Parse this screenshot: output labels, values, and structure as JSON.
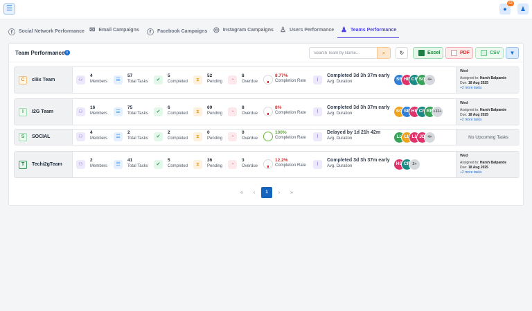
{
  "topbar": {
    "notification_count": "63"
  },
  "tabs": [
    {
      "label": "Social Network Performance",
      "icon": "facebook-icon"
    },
    {
      "label": "Email Campaigns",
      "icon": "email-icon"
    },
    {
      "label": "Facebook Campaigns",
      "icon": "facebook-icon"
    },
    {
      "label": "Instagram Campaigns",
      "icon": "instagram-icon"
    },
    {
      "label": "Users Performance",
      "icon": "users-gear-icon"
    },
    {
      "label": "Teams Performance",
      "icon": "teams-icon",
      "active": true
    }
  ],
  "panel": {
    "title": "Team Performance",
    "search_placeholder": "Search Team by Name...",
    "export": {
      "excel": "Excel",
      "pdf": "PDF",
      "csv": "CSV"
    }
  },
  "colors": {
    "accent": "#4f46e5",
    "primary": "#1565c0",
    "danger": "#dc2626",
    "success": "#5aa831"
  },
  "teams": [
    {
      "badge": "C",
      "name": "cliix Team",
      "members": "4",
      "members_label": "Members",
      "total": "57",
      "total_label": "Total Tasks",
      "completed": "5",
      "completed_label": "Completed",
      "pending": "52",
      "pending_label": "Pending",
      "overdue": "8",
      "overdue_label": "Overdue",
      "rate": "8.77%",
      "rate_label": "Completion Rate",
      "duration": "Completed 3d 3h 37m early",
      "duration_label": "Avg. Duration",
      "avatars": [
        "SB",
        "HB",
        "CR",
        "SG"
      ],
      "more": "4+",
      "upcoming": {
        "day": "Wed",
        "assigned_prefix": "Assigned to:",
        "assigned": "Harsh Balpande",
        "due_prefix": "Due:",
        "due": "18 Aug 2025",
        "more": "+2 more tasks"
      }
    },
    {
      "badge": "I",
      "name": "I2G Team",
      "members": "16",
      "members_label": "Members",
      "total": "75",
      "total_label": "Total Tasks",
      "completed": "6",
      "completed_label": "Completed",
      "pending": "69",
      "pending_label": "Pending",
      "overdue": "8",
      "overdue_label": "Overdue",
      "rate": "8%",
      "rate_label": "Completion Rate",
      "duration": "Completed 3d 3h 37m early",
      "duration_label": "Avg. Duration",
      "avatars": [
        "SG",
        "SB",
        "HB",
        "CR",
        "RR"
      ],
      "more": "+11+",
      "upcoming": {
        "day": "Wed",
        "assigned_prefix": "Assigned to:",
        "assigned": "Harsh Balpande",
        "due_prefix": "Due:",
        "due": "18 Aug 2025",
        "more": "+2 more tasks"
      }
    },
    {
      "badge": "S",
      "name": "SOCIAL",
      "members": "4",
      "members_label": "Members",
      "total": "2",
      "total_label": "Total Tasks",
      "completed": "2",
      "completed_label": "Completed",
      "pending": "0",
      "pending_label": "Pending",
      "overdue": "0",
      "overdue_label": "Overdue",
      "rate": "100%",
      "rate_label": "Completion Rate",
      "duration": "Delayed by 1d 21h 42m",
      "duration_label": "Avg. Duration",
      "avatars": [
        "LL",
        "LL",
        "LL",
        "JD"
      ],
      "more": "4+",
      "upcoming_none": "No Upcoming Tasks"
    },
    {
      "badge": "T",
      "name": "Techi2gTeam",
      "members": "2",
      "members_label": "Members",
      "total": "41",
      "total_label": "Total Tasks",
      "completed": "5",
      "completed_label": "Completed",
      "pending": "36",
      "pending_label": "Pending",
      "overdue": "3",
      "overdue_label": "Overdue",
      "rate": "12.2%",
      "rate_label": "Completion Rate",
      "duration": "Completed 3d 3h 37m early",
      "duration_label": "Avg. Duration",
      "avatars": [
        "HB",
        "CR"
      ],
      "more": "2+",
      "upcoming": {
        "day": "Wed",
        "assigned_prefix": "Assigned to:",
        "assigned": "Harsh Balpande",
        "due_prefix": "Due:",
        "due": "18 Aug 2025",
        "more": "+2 more tasks"
      }
    }
  ],
  "pagination": {
    "first": "«",
    "prev": "‹",
    "current": "1",
    "next": "›",
    "last": "»"
  }
}
